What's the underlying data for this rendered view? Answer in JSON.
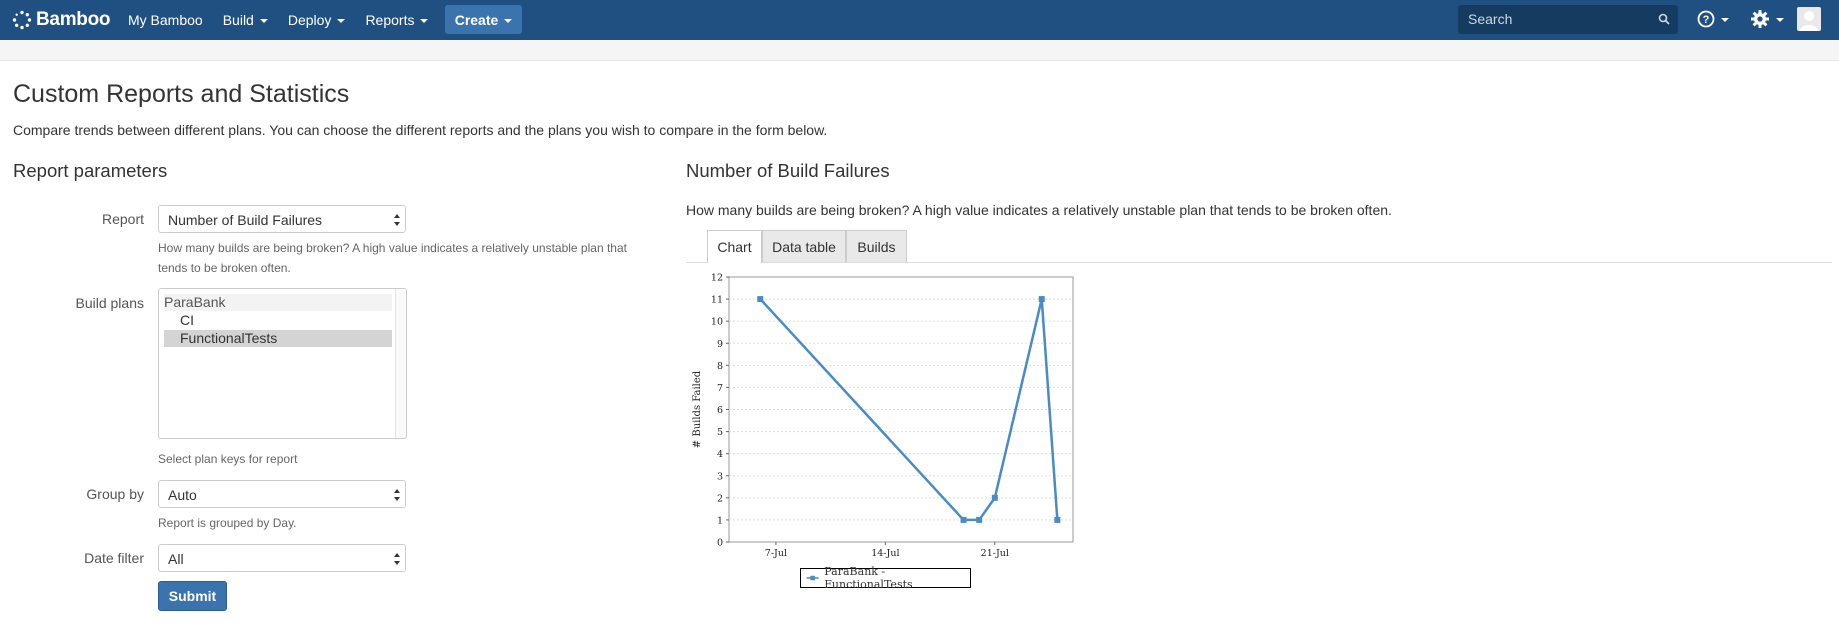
{
  "header": {
    "brand": "Bamboo",
    "nav": [
      "My Bamboo",
      "Build",
      "Deploy",
      "Reports"
    ],
    "create_label": "Create",
    "search_placeholder": "Search",
    "colors": {
      "bar": "#205081",
      "button": "#3b73af"
    }
  },
  "page": {
    "title": "Custom Reports and Statistics",
    "description": "Compare trends between different plans. You can choose the different reports and the plans you wish to compare in the form below."
  },
  "form": {
    "heading": "Report parameters",
    "report_label": "Report",
    "report_value": "Number of Build Failures",
    "report_help": "How many builds are being broken? A high value indicates a relatively unstable plan that tends to be broken often.",
    "build_plans_label": "Build plans",
    "build_plans": [
      {
        "label": "ParaBank",
        "group": true,
        "selected": false
      },
      {
        "label": "CI",
        "group": false,
        "selected": false
      },
      {
        "label": "FunctionalTests",
        "group": false,
        "selected": true
      }
    ],
    "build_plans_help": "Select plan keys for report",
    "group_by_label": "Group by",
    "group_by_value": "Auto",
    "group_by_help": "Report is grouped by Day.",
    "date_filter_label": "Date filter",
    "date_filter_value": "All",
    "submit_label": "Submit"
  },
  "report": {
    "heading": "Number of Build Failures",
    "description": "How many builds are being broken? A high value indicates a relatively unstable plan that tends to be broken often.",
    "tabs": [
      {
        "label": "Chart",
        "active": true
      },
      {
        "label": "Data table",
        "active": false
      },
      {
        "label": "Builds",
        "active": false
      }
    ]
  },
  "chart_data": {
    "type": "line",
    "ylabel": "# Builds Failed",
    "ylim": [
      0,
      12
    ],
    "yticks": [
      "0",
      "1",
      "2",
      "3",
      "4",
      "5",
      "6",
      "7",
      "8",
      "9",
      "10",
      "11",
      "12"
    ],
    "xticks": [
      "7-Jul",
      "14-Jul",
      "21-Jul"
    ],
    "grid": true,
    "legend_position": "bottom",
    "series": [
      {
        "name": "ParaBank - FunctionalTests",
        "color": "#4a8bc6",
        "x": [
          "2014-07-06",
          "2014-07-19",
          "2014-07-20",
          "2014-07-21",
          "2014-07-24",
          "2014-07-25"
        ],
        "values": [
          11,
          1,
          1,
          2,
          11,
          1
        ]
      }
    ]
  }
}
